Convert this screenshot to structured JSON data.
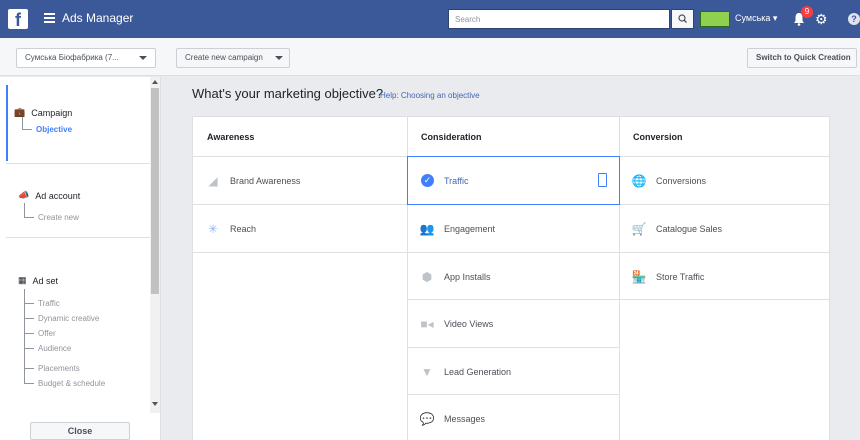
{
  "topbar": {
    "logo": "f",
    "app_title": "Ads Manager",
    "search_placeholder": "Search",
    "account_name": "Сумська",
    "notification_count": "9",
    "icons": [
      "hamburger-icon",
      "search-icon",
      "bell-icon",
      "gear-icon",
      "help-icon"
    ]
  },
  "subbar": {
    "account_select": "Сумська Біофабрика (7...",
    "create_campaign": "Create new campaign",
    "quick_creation": "Switch to Quick Creation"
  },
  "sidebar": {
    "campaign": {
      "label": "Campaign",
      "items": [
        "Objective"
      ]
    },
    "ad_account": {
      "label": "Ad account",
      "items": [
        "Create new"
      ]
    },
    "ad_set": {
      "label": "Ad set",
      "items": [
        "Traffic",
        "Dynamic creative",
        "Offer",
        "Audience",
        "Placements",
        "Budget & schedule"
      ]
    },
    "close_label": "Close"
  },
  "main": {
    "heading": "What's your marketing objective?",
    "help_link": "Help: Choosing an objective",
    "columns": [
      {
        "title": "Awareness",
        "items": [
          "Brand Awareness",
          "Reach"
        ]
      },
      {
        "title": "Consideration",
        "items": [
          "Traffic",
          "Engagement",
          "App Installs",
          "Video Views",
          "Lead Generation",
          "Messages"
        ]
      },
      {
        "title": "Conversion",
        "items": [
          "Conversions",
          "Catalogue Sales",
          "Store Traffic"
        ]
      }
    ],
    "selected": "Traffic",
    "colors": {
      "brand": "#3b5998",
      "accent": "#4080ff",
      "link": "#4267b2"
    }
  }
}
